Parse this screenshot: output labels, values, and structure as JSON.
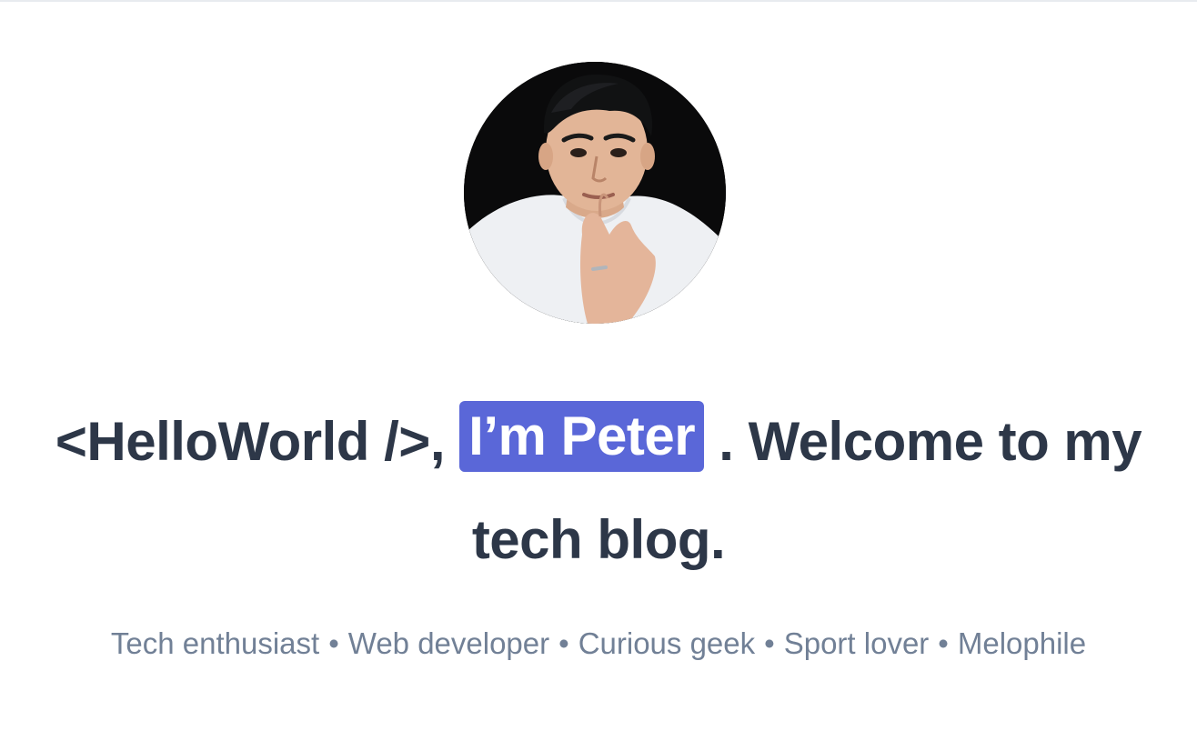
{
  "hero": {
    "avatar_alt": "Profile photo of Peter",
    "headline": {
      "part1": "<HelloWorld />,",
      "highlight": "I’m Peter",
      "part2": ". Welcome to my",
      "line2": "tech blog."
    },
    "tagline": {
      "items": [
        "Tech enthusiast",
        "Web developer",
        "Curious geek",
        "Sport lover",
        "Melophile"
      ],
      "separator": "•"
    }
  },
  "colors": {
    "heading": "#2d3748",
    "highlight_bg": "#5a67d8",
    "highlight_text": "#ffffff",
    "tagline": "#718096",
    "background": "#ffffff"
  }
}
